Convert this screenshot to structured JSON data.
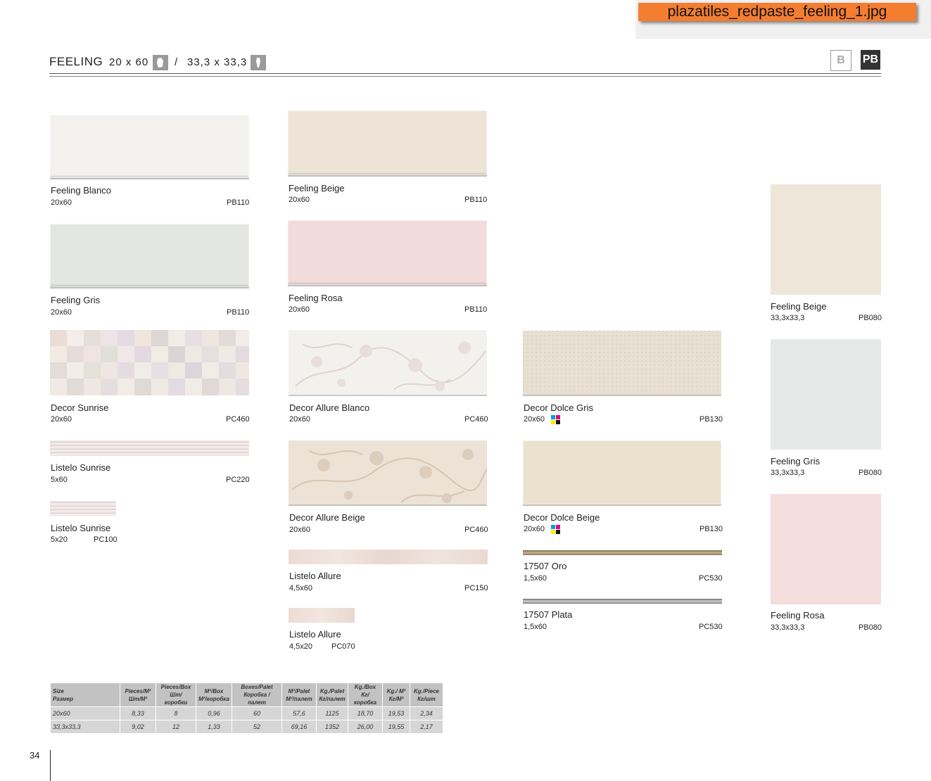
{
  "file_label": "plazatiles_redpaste_feeling_1.jpg",
  "header": {
    "title": "FEELING",
    "size_wall": "20 x 60",
    "separator": "/",
    "size_floor": "33,3 x 33,3",
    "badge_b": "B",
    "badge_pb": "PB"
  },
  "tiles": [
    {
      "name": "Feeling Blanco",
      "size": "20x60",
      "code": "PB110",
      "color": "#f4f2ef"
    },
    {
      "name": "Feeling Gris",
      "size": "20x60",
      "code": "PB110",
      "color": "#e4e6e4"
    },
    {
      "name": "Decor Sunrise",
      "size": "20x60",
      "code": "PC460"
    },
    {
      "name": "Listelo Sunrise",
      "size": "5x60",
      "code": "PC220"
    },
    {
      "name": "Listelo Sunrise",
      "size": "5x20",
      "code": "PC100"
    },
    {
      "name": "Feeling Beige",
      "size": "20x60",
      "code": "PB110",
      "color": "#eee3d7"
    },
    {
      "name": "Feeling Rosa",
      "size": "20x60",
      "code": "PB110",
      "color": "#f2dcdb"
    },
    {
      "name": "Decor Allure Blanco",
      "size": "20x60",
      "code": "PC460"
    },
    {
      "name": "Decor Allure Beige",
      "size": "20x60",
      "code": "PC460"
    },
    {
      "name": "Listelo Allure",
      "size": "4,5x60",
      "code": "PC150"
    },
    {
      "name": "Listelo Allure",
      "size": "4,5x20",
      "code": "PC070"
    },
    {
      "name": "Decor Dolce Gris",
      "size": "20x60",
      "code": "PB130"
    },
    {
      "name": "Decor Dolce Beige",
      "size": "20x60",
      "code": "PB130"
    },
    {
      "name": "17507 Oro",
      "size": "1,5x60",
      "code": "PC530"
    },
    {
      "name": "17507 Plata",
      "size": "1,5x60",
      "code": "PC530"
    },
    {
      "name": "Feeling Beige",
      "size": "33,3x33,3",
      "code": "PB080",
      "color": "#efe6da"
    },
    {
      "name": "Feeling Gris",
      "size": "33,3x33,3",
      "code": "PB080",
      "color": "#e7e9e8"
    },
    {
      "name": "Feeling Rosa",
      "size": "33,3x33,3",
      "code": "PB080",
      "color": "#f3dedd"
    }
  ],
  "spec_table": {
    "headers": [
      [
        "Size",
        "Размер"
      ],
      [
        "Pieces/M²",
        "Шт/М²"
      ],
      [
        "Pieces/Box",
        "Шт/ коробки"
      ],
      [
        "M²/Box",
        "М²/коробка"
      ],
      [
        "Boxes/Palet",
        "Коробка / палет"
      ],
      [
        "M²/Palet",
        "М²/палет"
      ],
      [
        "Kg./Palet",
        "Кг/палет"
      ],
      [
        "Kg./Box",
        "Кг/ коробка"
      ],
      [
        "Kg./ M²",
        "Кг/М²"
      ],
      [
        "Kg./Piece",
        "Кг/шт"
      ]
    ],
    "rows": [
      [
        "20x60",
        "8,33",
        "8",
        "0,96",
        "60",
        "57,6",
        "1125",
        "18,70",
        "19,53",
        "2,34"
      ],
      [
        "33,3x33,3",
        "9,02",
        "12",
        "1,33",
        "52",
        "69,16",
        "1352",
        "26,00",
        "19,55",
        "2,17"
      ]
    ]
  },
  "page_number": "34"
}
